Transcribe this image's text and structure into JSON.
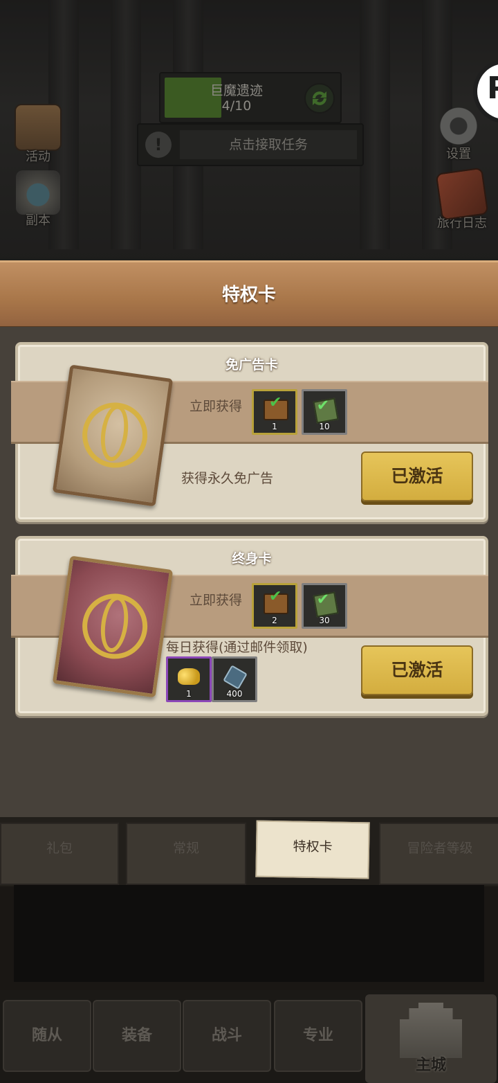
{
  "hud": {
    "quest_progress": {
      "name": "巨魔遗迹",
      "count": "4/10",
      "progress": 0.4
    },
    "task_prompt": "点击接取任务",
    "side_buttons": {
      "activity": "活动",
      "dungeon": "副本",
      "settings": "设置",
      "journal": "旅行日志"
    }
  },
  "panel": {
    "title": "特权卡",
    "cards": [
      {
        "title": "免广告卡",
        "instant_label": "立即获得",
        "instant_rewards": [
          {
            "icon": "chest-icon",
            "qty": "1",
            "frame": "gold"
          },
          {
            "icon": "ticket-icon",
            "qty": "10",
            "frame": "gray"
          }
        ],
        "description": "获得永久免广告",
        "button": "已激活"
      },
      {
        "title": "终身卡",
        "instant_label": "立即获得",
        "instant_rewards": [
          {
            "icon": "chest-icon",
            "qty": "2",
            "frame": "gold"
          },
          {
            "icon": "ticket-icon",
            "qty": "30",
            "frame": "gray"
          }
        ],
        "daily_label": "每日获得(通过邮件领取)",
        "daily_rewards": [
          {
            "icon": "gold-ore-icon",
            "qty": "1",
            "frame": "purple"
          },
          {
            "icon": "gem-icon",
            "qty": "400",
            "frame": "gray"
          }
        ],
        "button": "已激活"
      }
    ]
  },
  "tabs": [
    "礼包",
    "常规",
    "特权卡",
    "冒险者等级"
  ],
  "active_tab": "特权卡",
  "bottom_nav": [
    "随从",
    "装备",
    "战斗",
    "专业",
    "主城"
  ],
  "colors": {
    "header": "#a87649",
    "card_bg": "#ddd5c2",
    "band": "#b89c7e",
    "button": "#e0bd50",
    "progress_fill": "#3b5a22"
  }
}
